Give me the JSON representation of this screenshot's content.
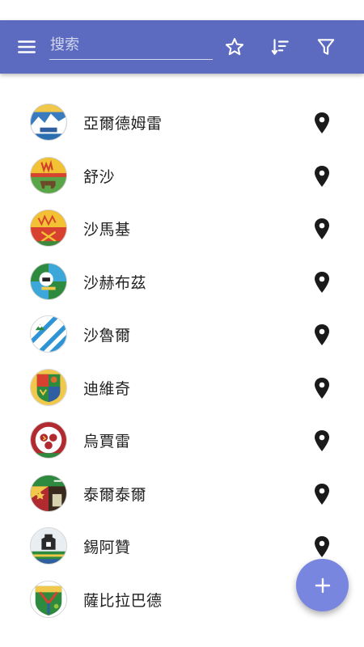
{
  "toolbar": {
    "background": "#5c6bc0",
    "menu_icon": "menu-icon",
    "search": {
      "placeholder": "搜索",
      "value": ""
    },
    "actions": [
      {
        "icon": "star-outline-icon"
      },
      {
        "icon": "sort-icon"
      },
      {
        "icon": "filter-icon"
      }
    ]
  },
  "list": {
    "items": [
      {
        "name": "亞爾德姆雷",
        "emblem": "azerbaijan-rayon-emblem",
        "action_icon": "map-pin-icon"
      },
      {
        "name": "舒沙",
        "emblem": "azerbaijan-rayon-emblem",
        "action_icon": "map-pin-icon"
      },
      {
        "name": "沙馬基",
        "emblem": "azerbaijan-rayon-emblem",
        "action_icon": "map-pin-icon"
      },
      {
        "name": "沙赫布茲",
        "emblem": "azerbaijan-rayon-emblem",
        "action_icon": "map-pin-icon"
      },
      {
        "name": "沙魯爾",
        "emblem": "azerbaijan-rayon-emblem",
        "action_icon": "map-pin-icon"
      },
      {
        "name": "迪維奇",
        "emblem": "azerbaijan-rayon-emblem",
        "action_icon": "map-pin-icon"
      },
      {
        "name": "烏賈雷",
        "emblem": "azerbaijan-rayon-emblem",
        "action_icon": "map-pin-icon"
      },
      {
        "name": "泰爾泰爾",
        "emblem": "azerbaijan-rayon-emblem",
        "action_icon": "map-pin-icon"
      },
      {
        "name": "錫阿贊",
        "emblem": "azerbaijan-rayon-emblem",
        "action_icon": "map-pin-icon"
      },
      {
        "name": "薩比拉巴德",
        "emblem": "azerbaijan-rayon-emblem",
        "action_icon": "map-pin-icon"
      }
    ]
  },
  "fab": {
    "icon": "plus-icon",
    "color": "#7986e0"
  }
}
